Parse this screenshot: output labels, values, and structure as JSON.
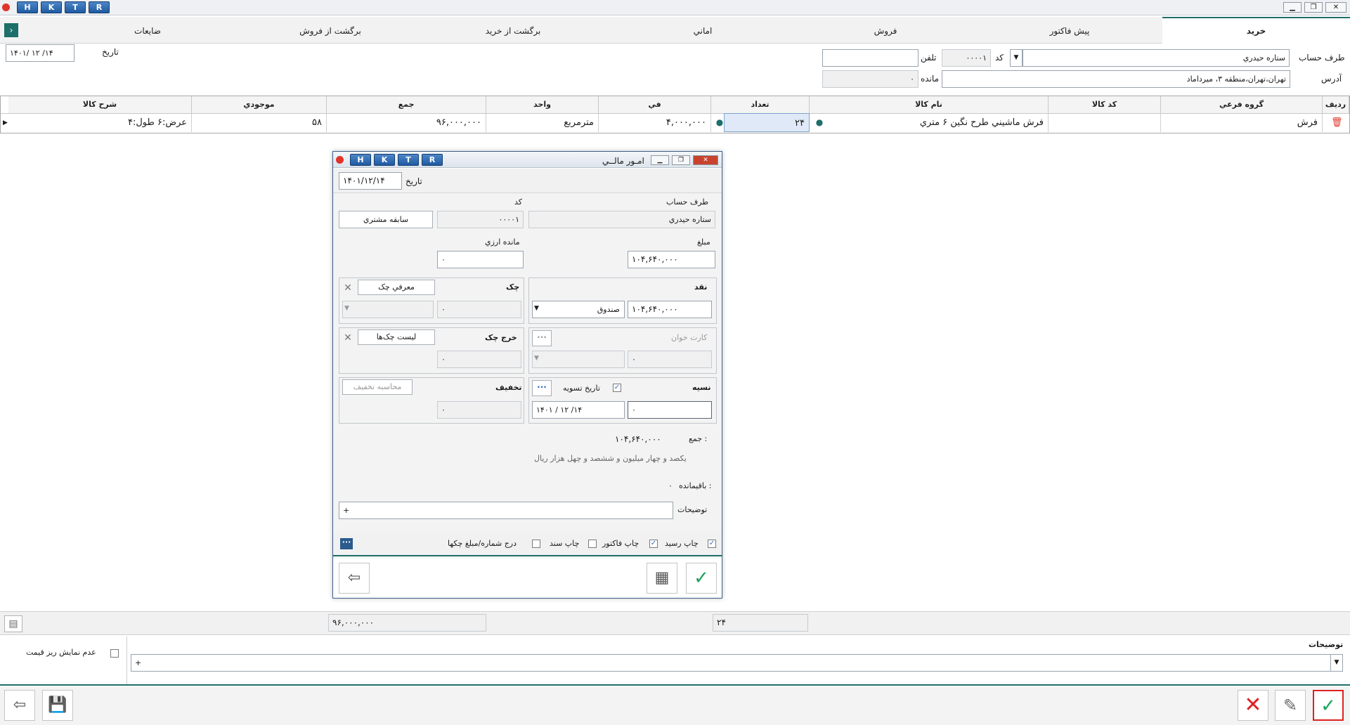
{
  "titlebar": {
    "keys": [
      "H",
      "K",
      "T",
      "R"
    ]
  },
  "tabs": [
    "خرید",
    "پیش فاکتور",
    "فروش",
    "اماني",
    "برگشت از خرید",
    "برگشت از فروش",
    "ضايعات"
  ],
  "header": {
    "account_label": "طرف حساب",
    "account_value": "ستاره حيدري",
    "code_label": "کد",
    "code_value": "۰۰۰۰۱",
    "phone_label": "تلفن",
    "phone_value": "",
    "address_label": "آدرس",
    "address_value": "تهران،تهران،منطقه ۳، ميرداماد",
    "balance_label": "مانده",
    "balance_value": "۰",
    "date_label": "تاريخ",
    "date_value": "۱۴۰۱/ ۱۲ /۱۴"
  },
  "grid": {
    "columns": [
      "رديف",
      "گروه فرعي",
      "کد کالا",
      "نام کالا",
      "تعداد",
      "في",
      "واحد",
      "جمع",
      "موجودي",
      "شرح کالا"
    ],
    "row": {
      "group": "فرش",
      "code": "",
      "name": "فرش ماشيني طرح نگين ۶ متري",
      "qty": "۲۴",
      "price": "۴,۰۰۰,۰۰۰",
      "unit": "مترمربع",
      "total": "۹۶,۰۰۰,۰۰۰",
      "stock": "۵۸",
      "desc": "عرض:۶  طول:۴"
    }
  },
  "dialog": {
    "title": "امـور مالــي",
    "keys": [
      "H",
      "K",
      "T",
      "R"
    ],
    "date_label": "تاريخ",
    "date_value": "۱۴۰۱/۱۲/۱۴",
    "account_label": "طرف حساب",
    "account_value": "ستاره حيدري",
    "code_label": "کد",
    "code_value": "۰۰۰۰۱",
    "history_btn": "سابقه مشتري",
    "amount_label": "مبلغ",
    "amount_value": "۱۰۴,۶۴۰,۰۰۰",
    "fx_balance_label": "مانده ارزي",
    "fx_balance_value": "۰",
    "cash_label": "نقد",
    "cash_value": "۱۰۴,۶۴۰,۰۰۰",
    "cash_box": "صندوق",
    "cheque_label": "چک",
    "cheque_btn": "معرفي چک",
    "cheque_value": "۰",
    "card_label": "کارت خوان",
    "card_value": "۰",
    "cheque_out_label": "خرج چک",
    "cheque_list_btn": "ليست چک‌ها",
    "cheque_out_value": "۰",
    "credit_label": "نسيه",
    "settle_date_label": "تاريخ تسويه",
    "credit_value": "۰",
    "settle_date_value": "۱۴۰۱   / ۱۲ /۱۴",
    "discount_label": "تخفيف",
    "discount_btn": "محاسبه تخفيف",
    "discount_value": "۰",
    "sum_label": "جمع :",
    "sum_value": "۱۰۴,۶۴۰,۰۰۰",
    "sum_words": "يکصد و چهار ميليون  و ششصد و چهل هزار  ريال",
    "remaining_label": "باقيمانده :",
    "remaining_value": "۰",
    "notes_label": "توضيحات",
    "notes_value": "+",
    "print_receipt": "چاپ رسيد",
    "print_invoice": "چاپ فاکتور",
    "print_doc": "چاپ سند",
    "insert_cheque": "درج شماره/مبلغ چکها"
  },
  "summary": {
    "total": "۹۶,۰۰۰,۰۰۰",
    "qty": "۲۴"
  },
  "footer": {
    "notes_label": "توضيحات",
    "notes_value": "+",
    "hide_price_label": "عدم نمايش ريز قيمت"
  },
  "colors": {
    "accent": "#2a6fc0",
    "confirm": "#1aa35a",
    "cancel": "#e02020"
  }
}
